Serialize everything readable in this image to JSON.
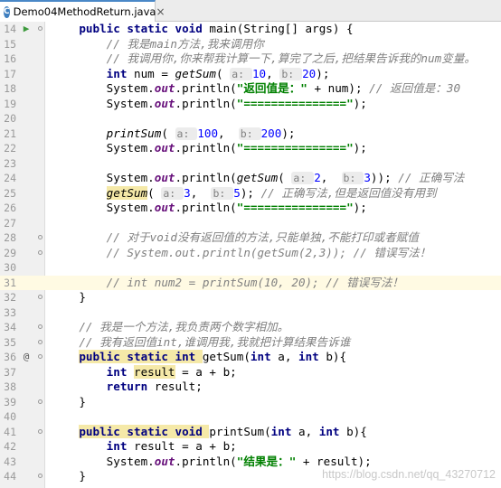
{
  "tab": {
    "icon_letter": "C",
    "title": "Demo04MethodReturn.java",
    "close": "×"
  },
  "lines": [
    {
      "no": "14",
      "icon": "run",
      "fold": true,
      "segs": [
        [
          "    ",
          ""
        ],
        [
          "public static void ",
          "kw"
        ],
        [
          "main(String[] args) {",
          ""
        ]
      ]
    },
    {
      "no": "15",
      "segs": [
        [
          "        ",
          ""
        ],
        [
          "// 我是",
          "cmt"
        ],
        [
          "main",
          "cmt"
        ],
        [
          "方法,我来调用你",
          "cmt"
        ]
      ]
    },
    {
      "no": "16",
      "segs": [
        [
          "        ",
          ""
        ],
        [
          "// 我调用你,你来帮我计算一下,算完了之后,把结果告诉我的",
          "cmt"
        ],
        [
          "num",
          "cmt"
        ],
        [
          "变量。",
          "cmt"
        ]
      ]
    },
    {
      "no": "17",
      "segs": [
        [
          "        ",
          ""
        ],
        [
          "int ",
          "kw"
        ],
        [
          "num = ",
          ""
        ],
        [
          "getSum",
          "it"
        ],
        [
          "( ",
          ""
        ],
        [
          "a: ",
          "hint"
        ],
        [
          "10",
          "num"
        ],
        [
          ", ",
          ""
        ],
        [
          "b: ",
          "hint"
        ],
        [
          "20",
          "num"
        ],
        [
          ");",
          ""
        ]
      ]
    },
    {
      "no": "18",
      "segs": [
        [
          "        ",
          ""
        ],
        [
          "System.",
          ""
        ],
        [
          "out",
          "static"
        ],
        [
          ".println(",
          ""
        ],
        [
          "\"返回值是：\"",
          "str"
        ],
        [
          " + num); ",
          ""
        ],
        [
          "// 返回值是：30",
          "cmt"
        ]
      ]
    },
    {
      "no": "19",
      "segs": [
        [
          "        ",
          ""
        ],
        [
          "System.",
          ""
        ],
        [
          "out",
          "static"
        ],
        [
          ".println(",
          ""
        ],
        [
          "\"===============\"",
          "str"
        ],
        [
          ");",
          ""
        ]
      ]
    },
    {
      "no": "20",
      "segs": []
    },
    {
      "no": "21",
      "segs": [
        [
          "        ",
          ""
        ],
        [
          "printSum",
          "it"
        ],
        [
          "( ",
          ""
        ],
        [
          "a: ",
          "hint"
        ],
        [
          "100",
          "num"
        ],
        [
          ",  ",
          ""
        ],
        [
          "b: ",
          "hint"
        ],
        [
          "200",
          "num"
        ],
        [
          ");",
          ""
        ]
      ]
    },
    {
      "no": "22",
      "segs": [
        [
          "        ",
          ""
        ],
        [
          "System.",
          ""
        ],
        [
          "out",
          "static"
        ],
        [
          ".println(",
          ""
        ],
        [
          "\"===============\"",
          "str"
        ],
        [
          ");",
          ""
        ]
      ]
    },
    {
      "no": "23",
      "segs": []
    },
    {
      "no": "24",
      "segs": [
        [
          "        ",
          ""
        ],
        [
          "System.",
          ""
        ],
        [
          "out",
          "static"
        ],
        [
          ".println(",
          ""
        ],
        [
          "getSum",
          "it"
        ],
        [
          "( ",
          ""
        ],
        [
          "a: ",
          "hint"
        ],
        [
          "2",
          "num"
        ],
        [
          ",  ",
          ""
        ],
        [
          "b: ",
          "hint"
        ],
        [
          "3",
          "num"
        ],
        [
          ")); ",
          ""
        ],
        [
          "// 正确写法",
          "cmt"
        ]
      ]
    },
    {
      "no": "25",
      "segs": [
        [
          "        ",
          ""
        ],
        [
          "getSum",
          "it hl"
        ],
        [
          "( ",
          ""
        ],
        [
          "a: ",
          "hint"
        ],
        [
          "3",
          "num"
        ],
        [
          ",  ",
          ""
        ],
        [
          "b: ",
          "hint"
        ],
        [
          "5",
          "num"
        ],
        [
          "); ",
          ""
        ],
        [
          "// 正确写法,但是返回值没有用到",
          "cmt"
        ]
      ]
    },
    {
      "no": "26",
      "segs": [
        [
          "        ",
          ""
        ],
        [
          "System.",
          ""
        ],
        [
          "out",
          "static"
        ],
        [
          ".println(",
          ""
        ],
        [
          "\"===============\"",
          "str"
        ],
        [
          ");",
          ""
        ]
      ]
    },
    {
      "no": "27",
      "segs": []
    },
    {
      "no": "28",
      "fold": true,
      "segs": [
        [
          "        ",
          ""
        ],
        [
          "// 对于",
          "cmt"
        ],
        [
          "void",
          "cmt"
        ],
        [
          "没有返回值的方法,只能单独,不能打印或者赋值",
          "cmt"
        ]
      ]
    },
    {
      "no": "29",
      "fold": true,
      "segs": [
        [
          "        ",
          ""
        ],
        [
          "// System.out.println(getSum(2,3)); // 错误写法！",
          "cmt"
        ]
      ]
    },
    {
      "no": "30",
      "segs": []
    },
    {
      "no": "31",
      "current": true,
      "segs": [
        [
          "        ",
          ""
        ],
        [
          "// int num2 = printSum(10, 20); // 错误写法！",
          "cmt"
        ]
      ]
    },
    {
      "no": "32",
      "fold": true,
      "segs": [
        [
          "    }",
          ""
        ]
      ]
    },
    {
      "no": "33",
      "segs": []
    },
    {
      "no": "34",
      "fold": true,
      "segs": [
        [
          "    ",
          ""
        ],
        [
          "// 我是一个方法,我负责两个数字相加。",
          "cmt"
        ]
      ]
    },
    {
      "no": "35",
      "fold": true,
      "segs": [
        [
          "    ",
          ""
        ],
        [
          "// 我有返回值",
          "cmt"
        ],
        [
          "int",
          "cmt"
        ],
        [
          ",谁调用我,我就把计算结果告诉谁",
          "cmt"
        ]
      ]
    },
    {
      "no": "36",
      "icon": "at",
      "fold": true,
      "segs": [
        [
          "    ",
          ""
        ],
        [
          "public static int ",
          "kw hl"
        ],
        [
          "getSum(",
          ""
        ],
        [
          "int ",
          "kw"
        ],
        [
          "a, ",
          ""
        ],
        [
          "int ",
          "kw"
        ],
        [
          "b){",
          ""
        ]
      ]
    },
    {
      "no": "37",
      "segs": [
        [
          "        ",
          ""
        ],
        [
          "int ",
          "kw"
        ],
        [
          "result",
          "hl"
        ],
        [
          " = a + b;",
          ""
        ]
      ]
    },
    {
      "no": "38",
      "segs": [
        [
          "        ",
          ""
        ],
        [
          "return ",
          "kw"
        ],
        [
          "result;",
          ""
        ]
      ]
    },
    {
      "no": "39",
      "fold": true,
      "segs": [
        [
          "    }",
          ""
        ]
      ]
    },
    {
      "no": "40",
      "segs": []
    },
    {
      "no": "41",
      "fold": true,
      "segs": [
        [
          "    ",
          ""
        ],
        [
          "public static void ",
          "kw hl"
        ],
        [
          "printSum(",
          ""
        ],
        [
          "int ",
          "kw"
        ],
        [
          "a, ",
          ""
        ],
        [
          "int ",
          "kw"
        ],
        [
          "b){",
          ""
        ]
      ]
    },
    {
      "no": "42",
      "segs": [
        [
          "        ",
          ""
        ],
        [
          "int ",
          "kw"
        ],
        [
          "result = a + b;",
          ""
        ]
      ]
    },
    {
      "no": "43",
      "segs": [
        [
          "        ",
          ""
        ],
        [
          "System.",
          ""
        ],
        [
          "out",
          "static"
        ],
        [
          ".println(",
          ""
        ],
        [
          "\"结果是：\"",
          "str"
        ],
        [
          " + result);",
          ""
        ]
      ]
    },
    {
      "no": "44",
      "fold": true,
      "segs": [
        [
          "    }",
          ""
        ]
      ]
    }
  ],
  "gutter_icons": {
    "run": "▶",
    "at": "@"
  },
  "watermark": "https://blog.csdn.net/qq_43270712"
}
